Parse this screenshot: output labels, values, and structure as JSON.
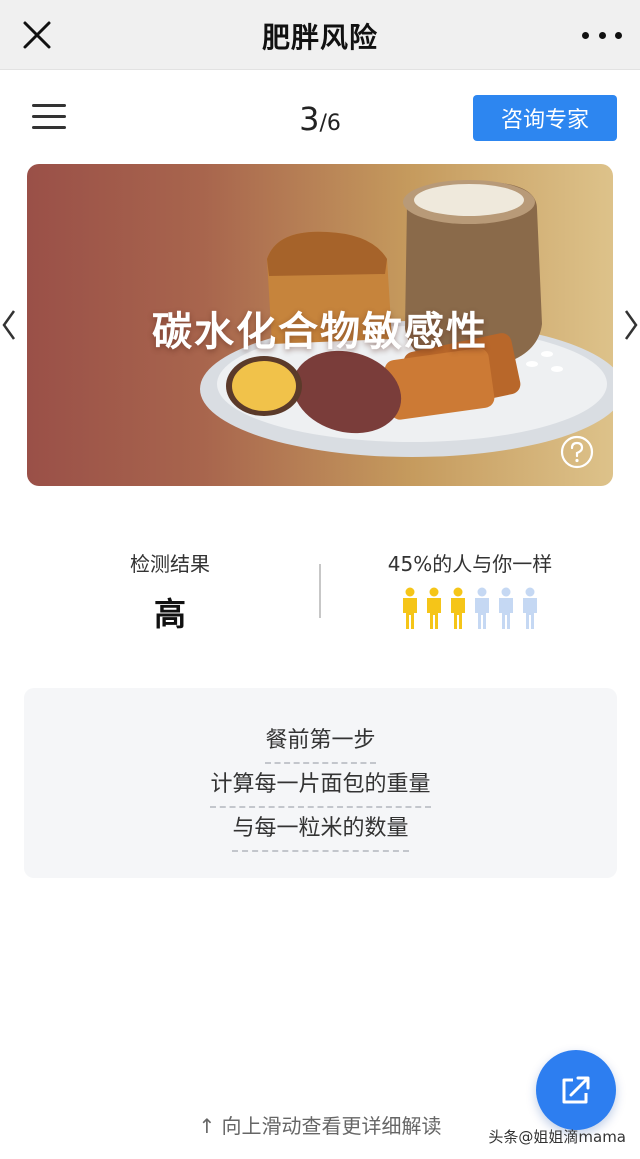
{
  "titlebar": {
    "title": "肥胖风险"
  },
  "header": {
    "page_current": "3",
    "page_separator": "/",
    "page_total": "6",
    "consult_label": "咨询专家"
  },
  "hero": {
    "title": "碳水化合物敏感性"
  },
  "result": {
    "label": "检测结果",
    "value": "高"
  },
  "similar": {
    "label": "45%的人与你一样",
    "percent": 45,
    "highlighted_people": 3,
    "total_people": 6,
    "highlight_color": "#f5c518",
    "dim_color": "#c5d8f3"
  },
  "tips": {
    "lines": [
      "餐前第一步",
      "计算每一片面包的重量",
      "与每一粒米的数量"
    ]
  },
  "footer": {
    "scroll_hint": "↑ 向上滑动查看更详细解读",
    "watermark": "头条@姐姐滴mama"
  },
  "colors": {
    "accent": "#2d86f0"
  }
}
